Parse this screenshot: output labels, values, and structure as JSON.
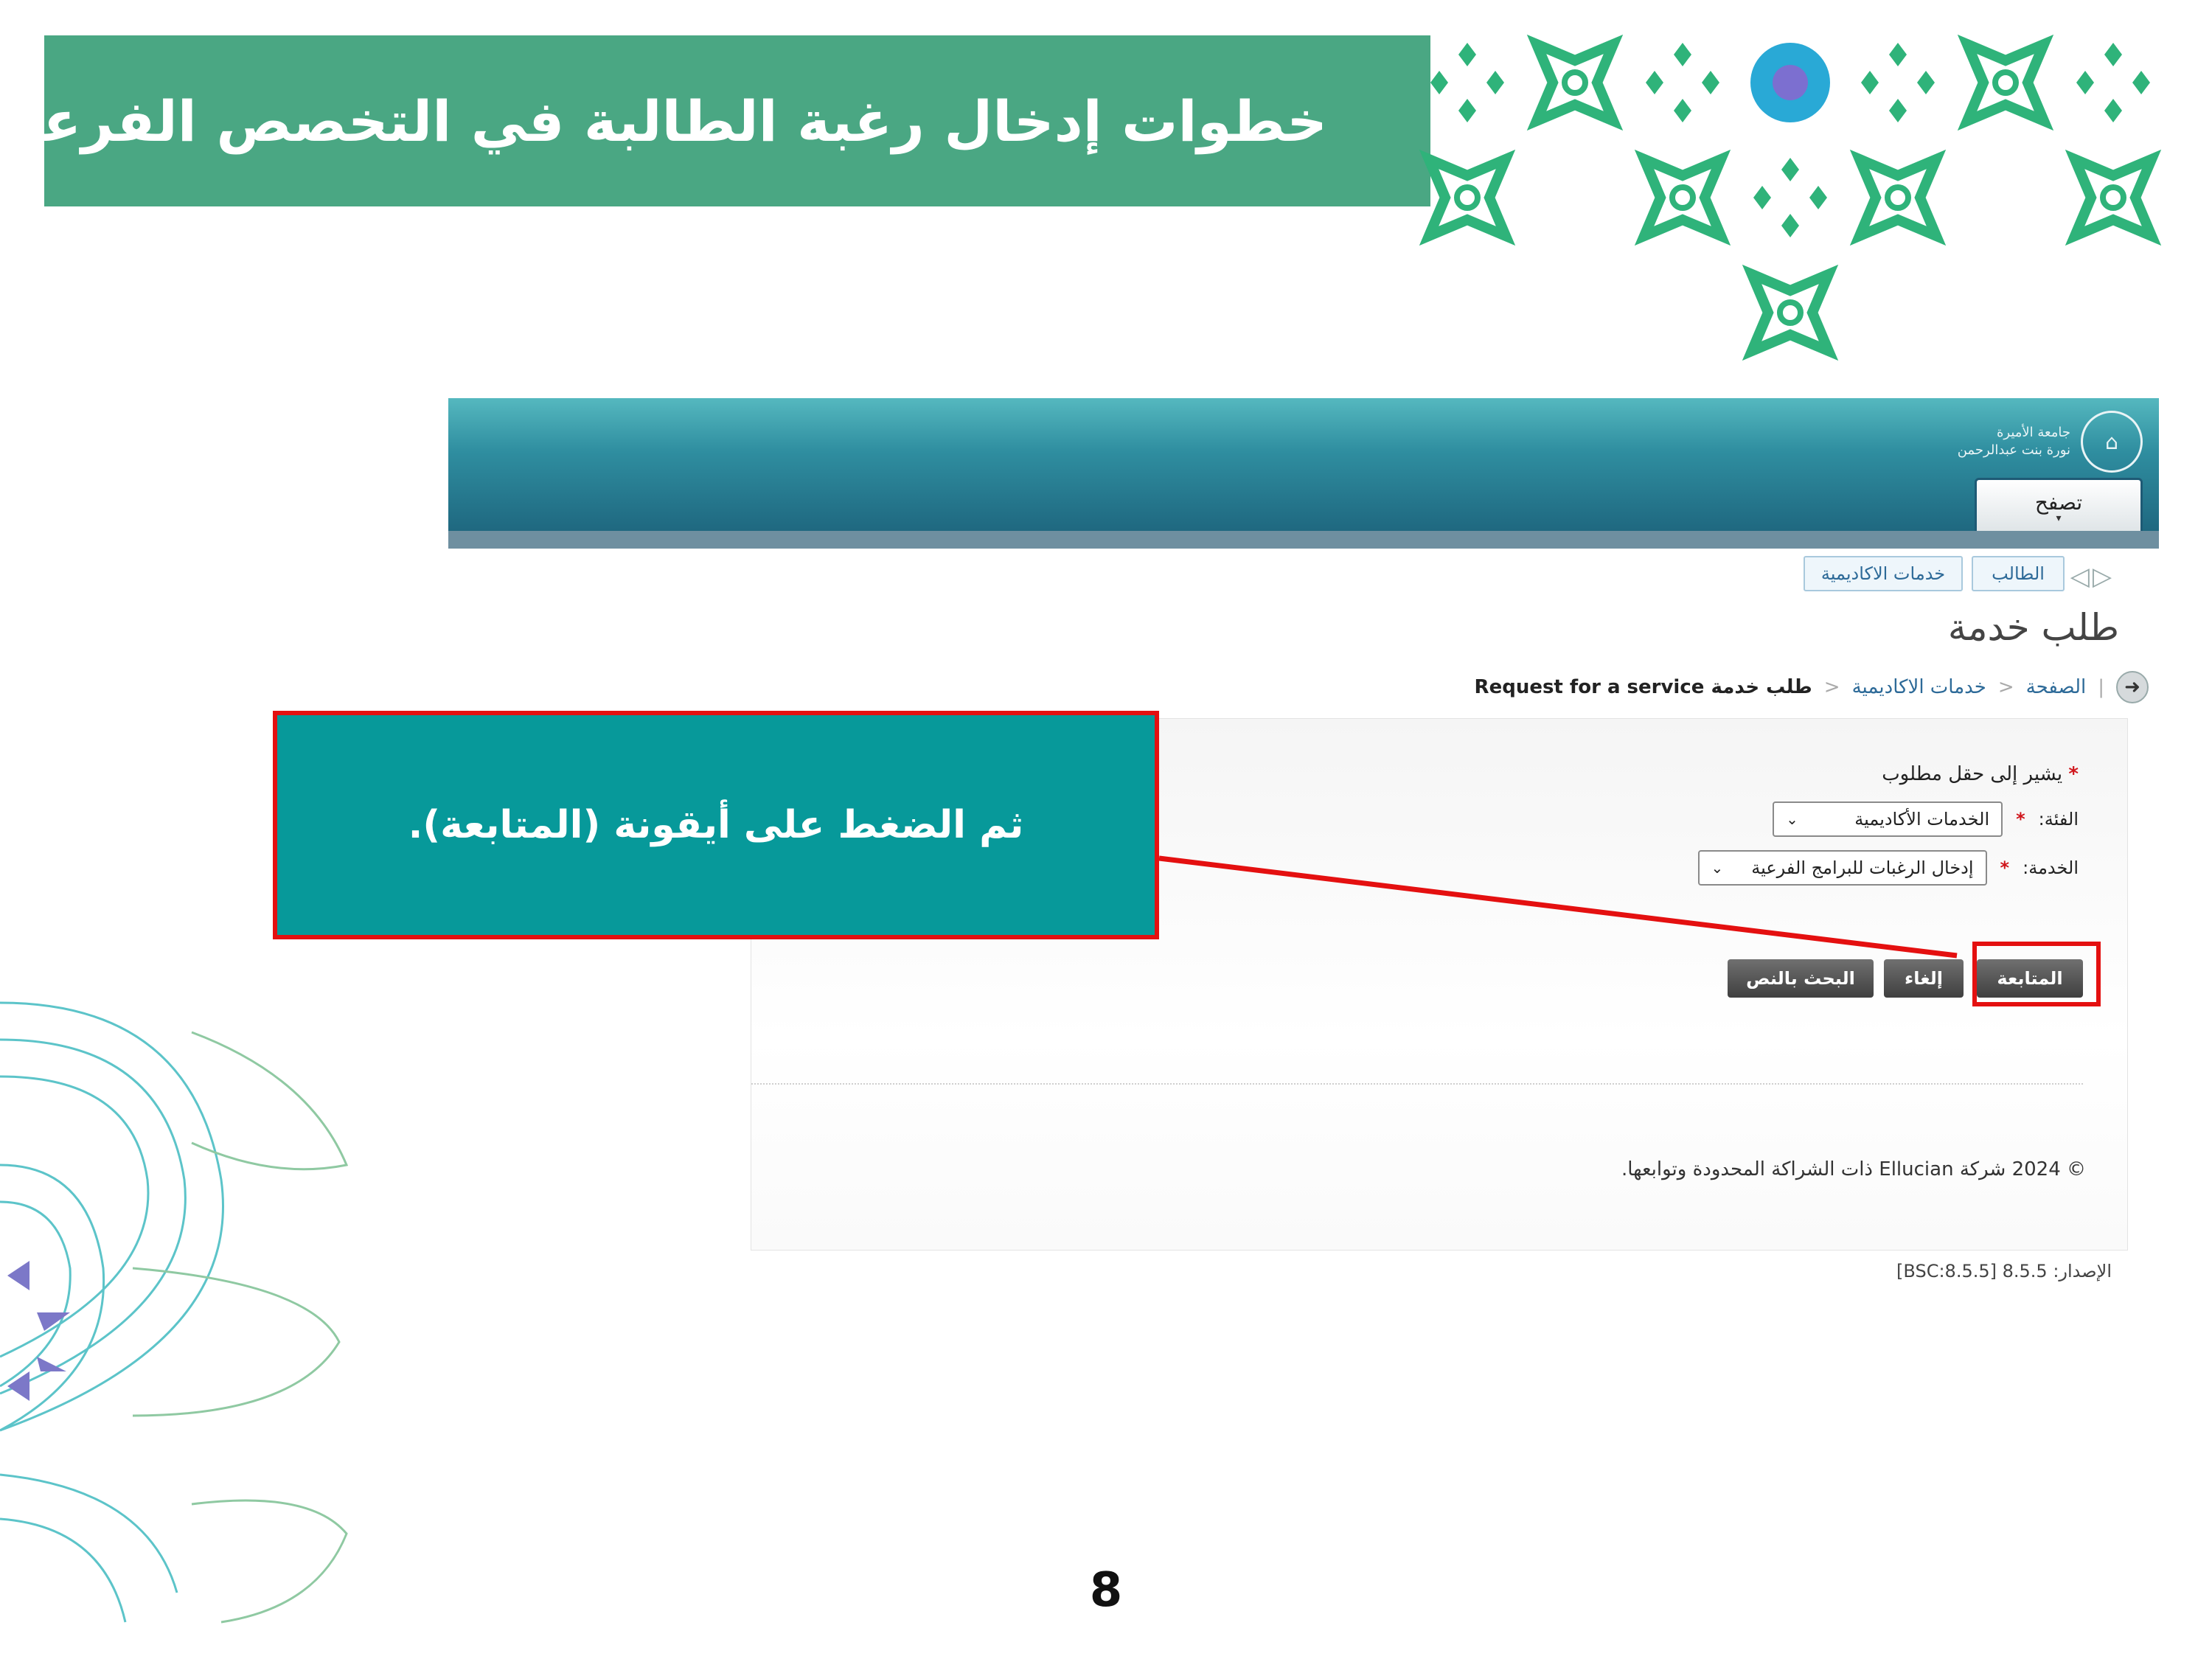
{
  "slide": {
    "title": "خطوات إدخال رغبة الطالبة في التخصص الفرعي",
    "callout_text": "ثم الضغط على أيقونة (المتابعة).",
    "page_number": "8"
  },
  "app": {
    "logo_line1": "جامعة الأميرة",
    "logo_line2": "نورة بنت عبدالرحمن",
    "browse_button": "تصفح",
    "tabs": [
      "الطالب",
      "خدمات الاكاديمية"
    ],
    "page_heading": "طلب خدمة",
    "breadcrumb": {
      "home": "الصفحة",
      "section": "خدمات الاكاديمية",
      "current": "طلب خدمة Request for a service"
    },
    "form": {
      "required_note": "يشير إلى حقل مطلوب",
      "category_label": "الفئة:",
      "category_value": "الخدمات الأكاديمية",
      "service_label": "الخدمة:",
      "service_value": "إدخال الرغبات للبرامج الفرعية"
    },
    "buttons": {
      "continue": "المتابعة",
      "cancel": "إلغاء",
      "text_search": "البحث بالنص"
    },
    "copyright": "© 2024 شركة Ellucian ذات الشراكة المحدودة وتوابعها.",
    "version": "الإصدار: 8.5.5 [BSC:8.5.5]"
  },
  "colors": {
    "title_bg": "#4aa783",
    "callout_bg": "#07999a",
    "highlight": "#e41010",
    "header_top": "#55b8bf",
    "header_bottom": "#1f6880"
  }
}
